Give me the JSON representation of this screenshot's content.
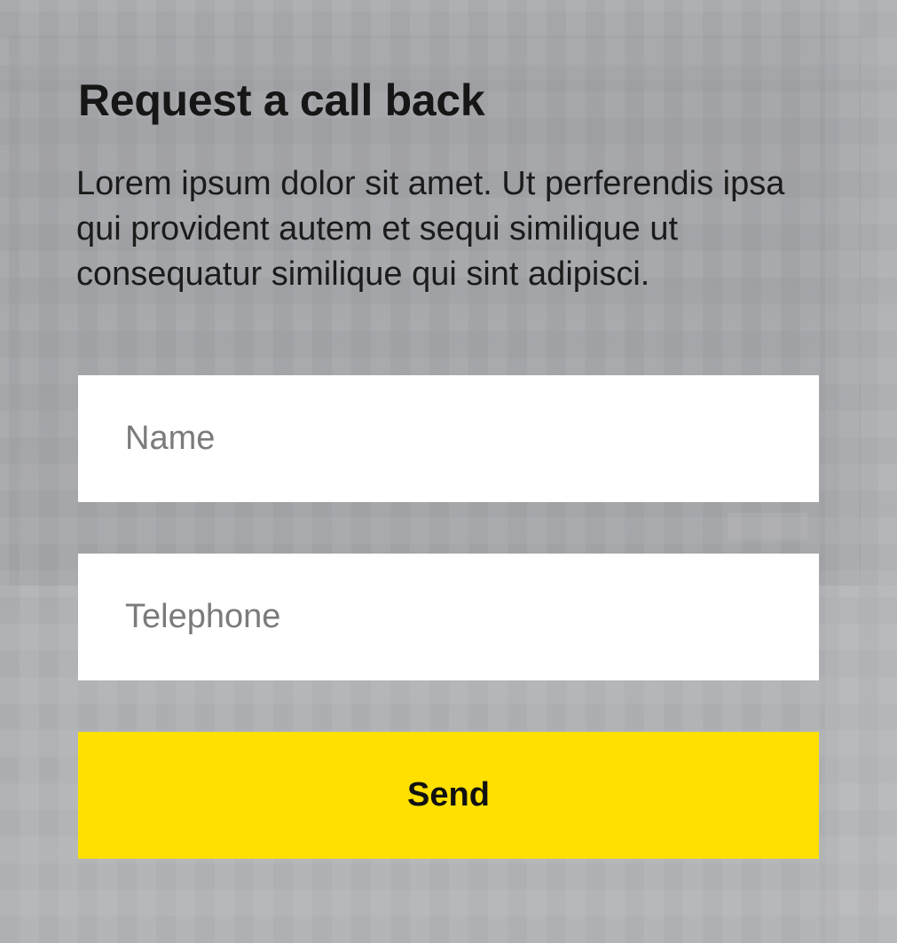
{
  "form": {
    "title": "Request a call back",
    "description": "Lorem ipsum dolor sit amet. Ut perferendis ipsa qui provident autem et sequi similique ut consequatur similique qui sint adipisci.",
    "name_field": {
      "placeholder": "Name",
      "value": ""
    },
    "telephone_field": {
      "placeholder": "Telephone",
      "value": ""
    },
    "send_label": "Send"
  },
  "colors": {
    "accent": "#ffe000",
    "background": "#a9abae",
    "field_background": "#ffffff",
    "text": "#161616"
  }
}
